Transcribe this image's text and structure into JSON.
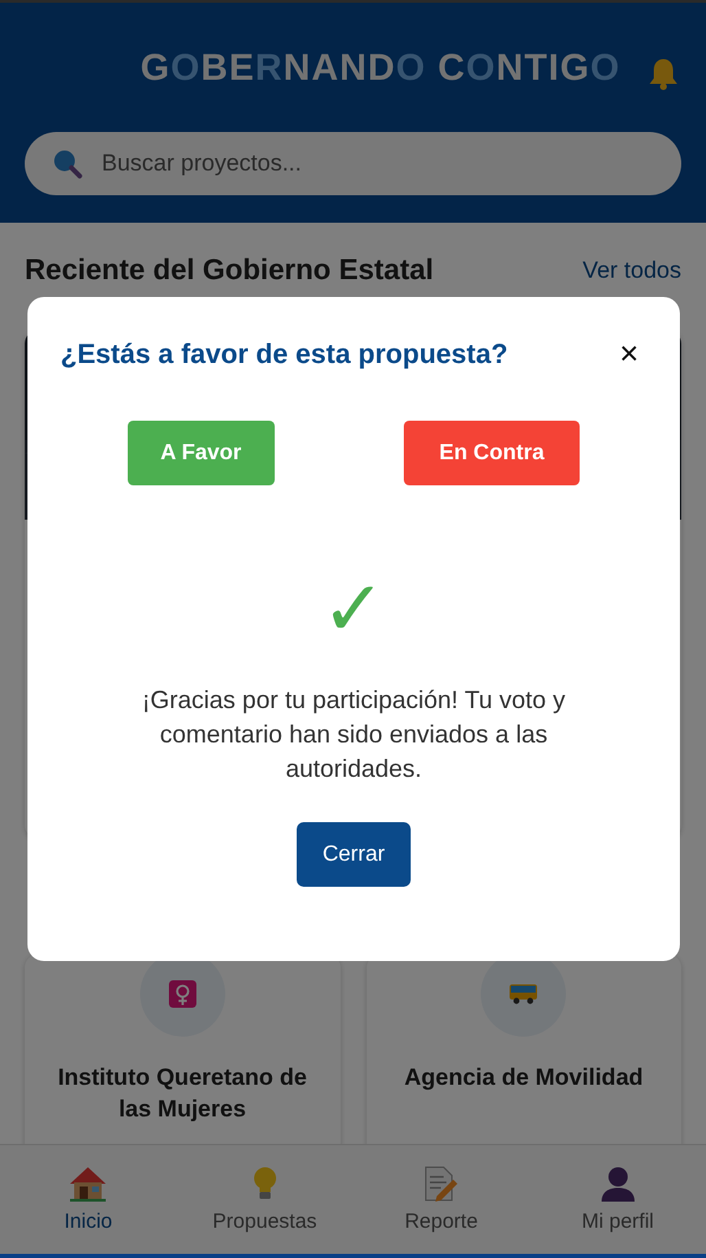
{
  "header": {
    "logo": [
      {
        "text": "G",
        "accent": false
      },
      {
        "text": "O",
        "accent": true
      },
      {
        "text": "BE",
        "accent": false
      },
      {
        "text": "R",
        "accent": true
      },
      {
        "text": "NAND",
        "accent": false
      },
      {
        "text": "O",
        "accent": true
      },
      {
        "text": " C",
        "accent": false
      },
      {
        "text": "O",
        "accent": true
      },
      {
        "text": "NTIG",
        "accent": false
      },
      {
        "text": "O",
        "accent": true
      }
    ]
  },
  "search": {
    "placeholder": "Buscar proyectos..."
  },
  "recent": {
    "title": "Reciente del Gobierno Estatal",
    "link": "Ver todos"
  },
  "agencies": [
    {
      "name": "Instituto Queretano de las Mujeres",
      "kind": "women"
    },
    {
      "name": "Agencia de Movilidad",
      "kind": "mobility"
    }
  ],
  "modal": {
    "title": "¿Estás a favor de esta propuesta?",
    "close": "×",
    "options": [
      {
        "label": "A Favor",
        "kind": "favor"
      },
      {
        "label": "En Contra",
        "kind": "contra"
      }
    ],
    "check": "✓",
    "message": "¡Gracias por tu participación! Tu voto y comentario han sido enviados a las autoridades.",
    "button": "Cerrar"
  },
  "nav": [
    {
      "label": "Inicio",
      "kind": "home",
      "selected": true
    },
    {
      "label": "Propuestas",
      "kind": "proposals",
      "selected": false
    },
    {
      "label": "Reporte",
      "kind": "report",
      "selected": false
    },
    {
      "label": "Mi perfil",
      "kind": "profile",
      "selected": false
    }
  ]
}
